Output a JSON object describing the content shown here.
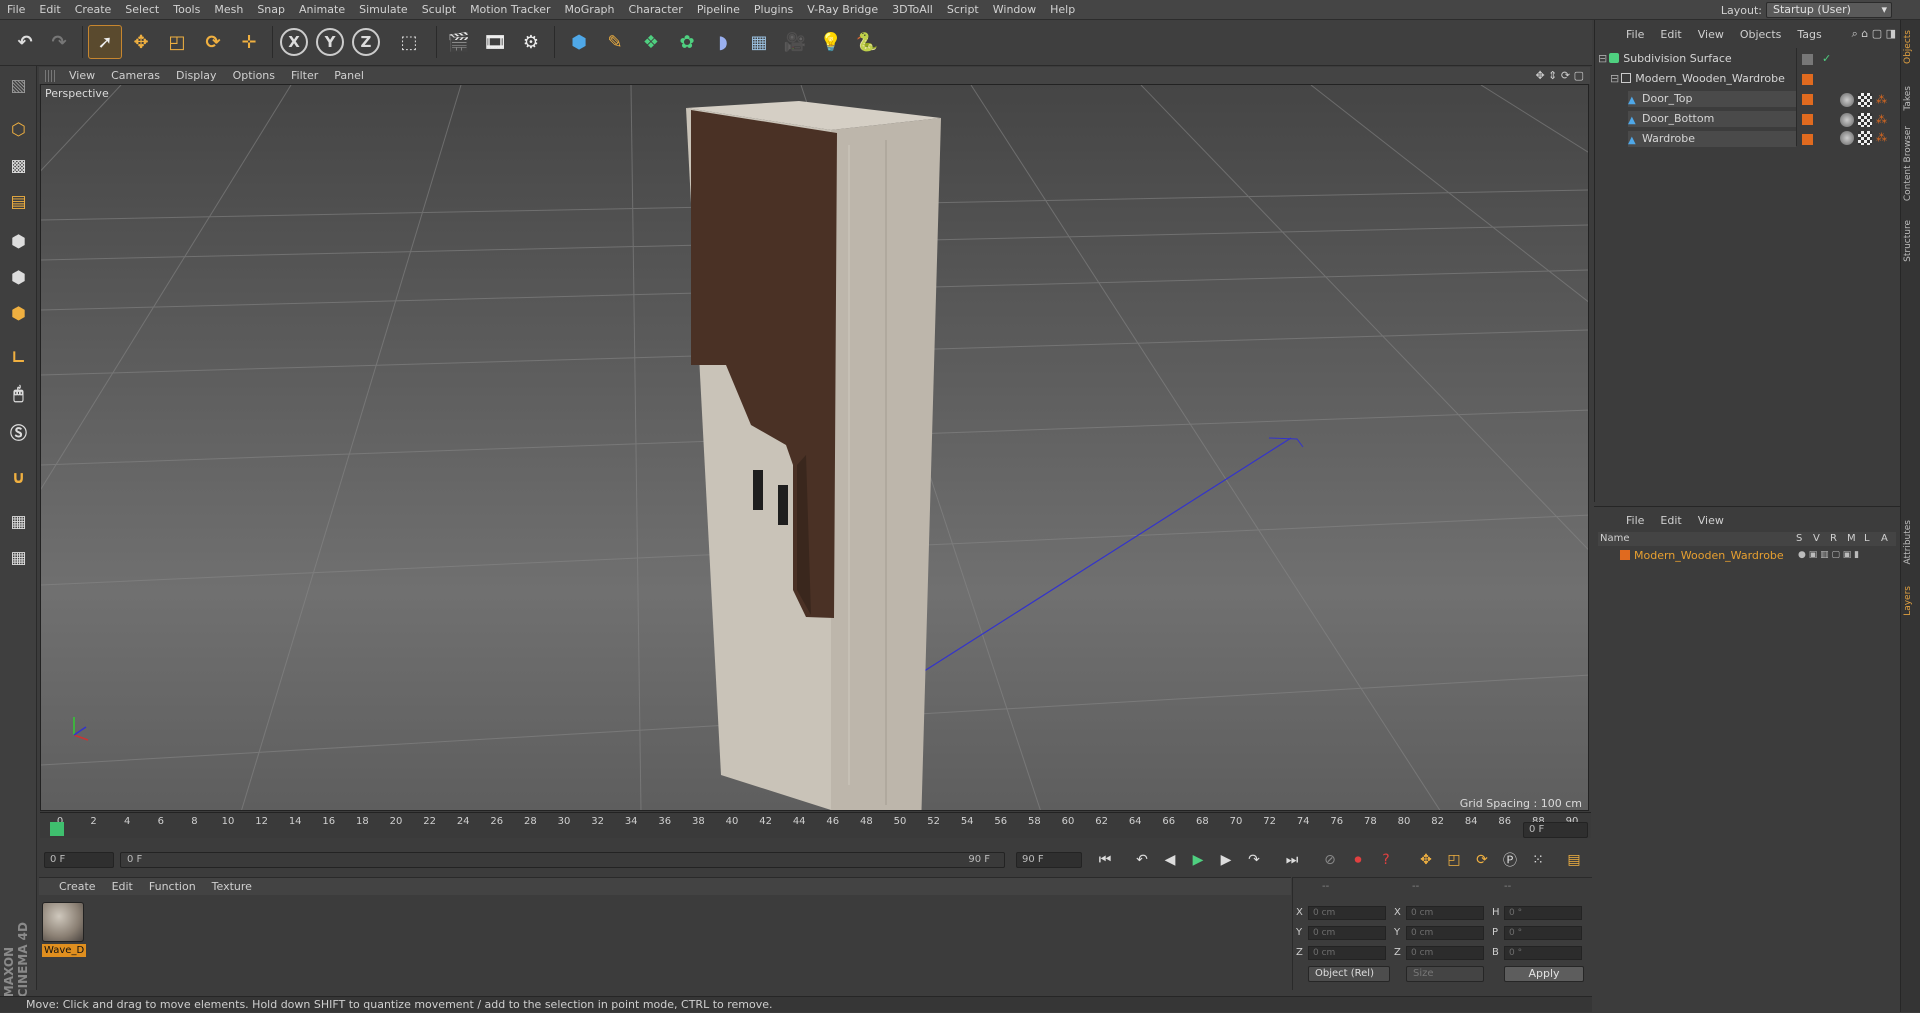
{
  "menu": {
    "items": [
      "File",
      "Edit",
      "Create",
      "Select",
      "Tools",
      "Mesh",
      "Snap",
      "Animate",
      "Simulate",
      "Sculpt",
      "Motion Tracker",
      "MoGraph",
      "Character",
      "Pipeline",
      "Plugins",
      "V-Ray Bridge",
      "3DToAll",
      "Script",
      "Window",
      "Help"
    ],
    "layout_label": "Layout:",
    "layout_value": "Startup (User)"
  },
  "viewport": {
    "menu": [
      "View",
      "Cameras",
      "Display",
      "Options",
      "Filter",
      "Panel"
    ],
    "label": "Perspective",
    "grid_spacing": "Grid Spacing : 100 cm"
  },
  "timeline": {
    "ticks": [
      "0",
      "2",
      "4",
      "6",
      "8",
      "10",
      "12",
      "14",
      "16",
      "18",
      "20",
      "22",
      "24",
      "26",
      "28",
      "30",
      "32",
      "34",
      "36",
      "38",
      "40",
      "42",
      "44",
      "46",
      "48",
      "50",
      "52",
      "54",
      "56",
      "58",
      "60",
      "62",
      "64",
      "66",
      "68",
      "70",
      "72",
      "74",
      "76",
      "78",
      "80",
      "82",
      "84",
      "86",
      "88",
      "90"
    ],
    "current_frame": "0 F",
    "start_field": "0 F",
    "range_start": "0 F",
    "range_end": "90 F",
    "end_field": "90 F",
    "end_display": "0 F"
  },
  "materials": {
    "menu": [
      "Create",
      "Edit",
      "Function",
      "Texture"
    ],
    "items": [
      {
        "label": "Wave_D"
      }
    ]
  },
  "coordinates": {
    "headers": [
      "--",
      "--",
      "--"
    ],
    "rows": [
      {
        "a": "X",
        "av": "0 cm",
        "b": "X",
        "bv": "0 cm",
        "c": "H",
        "cv": "0 °"
      },
      {
        "a": "Y",
        "av": "0 cm",
        "b": "Y",
        "bv": "0 cm",
        "c": "P",
        "cv": "0 °"
      },
      {
        "a": "Z",
        "av": "0 cm",
        "b": "Z",
        "bv": "0 cm",
        "c": "B",
        "cv": "0 °"
      }
    ],
    "mode": "Object (Rel)",
    "size_mode": "Size",
    "apply_label": "Apply"
  },
  "status": "Move: Click and drag to move elements. Hold down SHIFT to quantize movement / add to the selection in point mode, CTRL to remove.",
  "objects": {
    "menu": [
      "File",
      "Edit",
      "View",
      "Objects",
      "Tags"
    ],
    "tree": [
      {
        "label": "Subdivision Surface"
      },
      {
        "label": "Modern_Wooden_Wardrobe"
      },
      {
        "label": "Door_Top"
      },
      {
        "label": "Door_Bottom"
      },
      {
        "label": "Wardrobe"
      }
    ]
  },
  "layers": {
    "menu": [
      "File",
      "Edit",
      "View"
    ],
    "header_name": "Name",
    "header_cols": [
      "S",
      "V",
      "R",
      "M",
      "L",
      "A"
    ],
    "rows": [
      {
        "label": "Modern_Wooden_Wardrobe"
      }
    ]
  },
  "side_tabs": [
    "Objects",
    "Takes",
    "Content Browser",
    "Structure",
    "Attributes",
    "Layers"
  ],
  "brand": {
    "line1": "MAXON",
    "line2": "CINEMA 4D"
  },
  "colors": {
    "accent": "#e08f1f",
    "playhead": "#3fbf6e",
    "door_wood": "#4a3125",
    "carcass": "#c9c3b8"
  }
}
